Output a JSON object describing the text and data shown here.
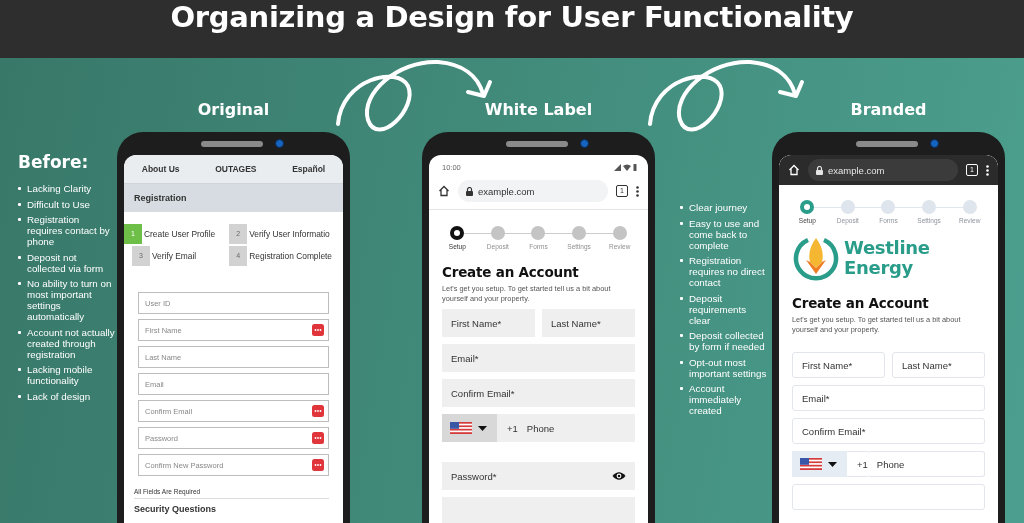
{
  "title": "Organizing a Design for User Functionality",
  "columns": [
    {
      "kind": "notes",
      "heading": "Before:",
      "items": [
        "Lacking Clarity",
        "Difficult to Use",
        "Registration requires contact by phone",
        "Deposit not collected via form",
        "No ability to turn on most important settings automatically",
        "Account not actually created through registration",
        "Lacking mobile functionality",
        "Lack of design"
      ]
    },
    {
      "kind": "original_phone",
      "label": "Original",
      "nav": [
        "About Us",
        "OUTAGES",
        "Español"
      ],
      "section_title": "Registration",
      "steps": [
        {
          "number": "1",
          "label": "Create User Profile",
          "selected": true
        },
        {
          "number": "2",
          "label": "Verify User Informatio",
          "selected": false
        },
        {
          "number": "3",
          "label": "Verify Email",
          "selected": false
        },
        {
          "number": "4",
          "label": "Registration Complete",
          "selected": false
        }
      ],
      "fields": [
        {
          "placeholder": "User ID",
          "alert": false
        },
        {
          "placeholder": "First Name",
          "alert": true
        },
        {
          "placeholder": "Last Name",
          "alert": false
        },
        {
          "placeholder": "Email",
          "alert": false
        },
        {
          "placeholder": "Confirm Email",
          "alert": true
        },
        {
          "placeholder": "Password",
          "alert": true
        },
        {
          "placeholder": "Confirm New Password",
          "alert": true
        }
      ],
      "note": "All Fields Are Required",
      "next_section": "Security Questions"
    },
    {
      "kind": "white_label_phone",
      "label": "White Label",
      "status_time": "10:00",
      "url": "example.com",
      "tab_count": "1",
      "steps": [
        {
          "label": "Setup",
          "selected": true
        },
        {
          "label": "Deposit",
          "selected": false
        },
        {
          "label": "Forms",
          "selected": false
        },
        {
          "label": "Settings",
          "selected": false
        },
        {
          "label": "Review",
          "selected": false
        }
      ],
      "heading": "Create an Account",
      "intro": "Let's get you setup. To get started tell us a bit about yourself and your property.",
      "form_rows": [
        {
          "fields": [
            {
              "kind": "text",
              "placeholder": "First Name*"
            },
            {
              "kind": "text",
              "placeholder": "Last Name*"
            }
          ]
        },
        {
          "fields": [
            {
              "kind": "text",
              "placeholder": "Email*"
            }
          ]
        },
        {
          "fields": [
            {
              "kind": "text",
              "placeholder": "Confirm Email*"
            }
          ]
        },
        {
          "fields": [
            {
              "kind": "phone",
              "dial_code": "+1",
              "placeholder": "Phone"
            }
          ]
        },
        {
          "fields": [
            {
              "kind": "password",
              "placeholder": "Password*"
            }
          ]
        },
        {
          "fields": [
            {
              "kind": "text"
            }
          ]
        }
      ]
    },
    {
      "kind": "notes",
      "items": [
        "Clear journey",
        "Easy to use and come back to complete",
        "Registration requires no direct contact",
        "Deposit requirements clear",
        "Deposit collected by form if needed",
        "Opt-out most important settings",
        "Account immediately created"
      ]
    },
    {
      "kind": "branded_phone",
      "label": "Branded",
      "url": "example.com",
      "tab_count": "1",
      "steps": [
        {
          "label": "Setup",
          "selected": true
        },
        {
          "label": "Deposit",
          "selected": false
        },
        {
          "label": "Forms",
          "selected": false
        },
        {
          "label": "Settings",
          "selected": false
        },
        {
          "label": "Review",
          "selected": false
        }
      ],
      "logo": "Westline Energy",
      "heading": "Create an Account",
      "intro": "Let's get you setup. To get started tell us a bit about yourself and your property.",
      "form_rows": [
        {
          "fields": [
            {
              "kind": "text",
              "placeholder": "First Name*"
            },
            {
              "kind": "text",
              "placeholder": "Last Name*"
            }
          ]
        },
        {
          "fields": [
            {
              "kind": "text",
              "placeholder": "Email*"
            }
          ]
        },
        {
          "fields": [
            {
              "kind": "text",
              "placeholder": "Confirm Email*"
            }
          ]
        },
        {
          "fields": [
            {
              "kind": "phone",
              "dial_code": "+1",
              "placeholder": "Phone"
            }
          ]
        },
        {
          "fields": [
            {
              "kind": "text"
            }
          ]
        }
      ]
    }
  ]
}
